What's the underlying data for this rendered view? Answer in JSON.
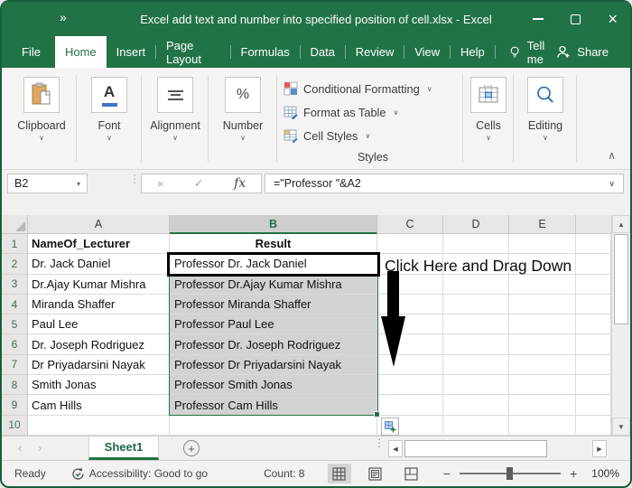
{
  "window": {
    "title": "Excel add text and number into specified position of cell.xlsx - Excel"
  },
  "tabs": {
    "items": [
      "File",
      "Home",
      "Insert",
      "Page Layout",
      "Formulas",
      "Data",
      "Review",
      "View",
      "Help"
    ],
    "active": "Home",
    "tell_me": "Tell me",
    "share": "Share"
  },
  "ribbon": {
    "clipboard": "Clipboard",
    "font": "Font",
    "alignment": "Alignment",
    "number": "Number",
    "styles_items": [
      "Conditional Formatting",
      "Format as Table",
      "Cell Styles"
    ],
    "styles_label": "Styles",
    "cells": "Cells",
    "editing": "Editing"
  },
  "formula_bar": {
    "name_box": "B2",
    "fx": "fx",
    "formula": "=\"Professor \"&A2"
  },
  "grid": {
    "columns": [
      "A",
      "B",
      "C",
      "D",
      "E"
    ],
    "selected_column": "B",
    "selected_range": "B2:B9",
    "rows": [
      {
        "n": "1",
        "a": "NameOf_Lecturer",
        "b": "Result"
      },
      {
        "n": "2",
        "a": "Dr. Jack Daniel",
        "b": "Professor Dr. Jack Daniel"
      },
      {
        "n": "3",
        "a": "Dr.Ajay Kumar Mishra",
        "b": "Professor Dr.Ajay Kumar Mishra"
      },
      {
        "n": "4",
        "a": "Miranda Shaffer",
        "b": "Professor Miranda Shaffer"
      },
      {
        "n": "5",
        "a": "Paul Lee",
        "b": "Professor Paul Lee"
      },
      {
        "n": "6",
        "a": "Dr. Joseph Rodriguez",
        "b": "Professor Dr. Joseph Rodriguez"
      },
      {
        "n": "7",
        "a": "Dr Priyadarsini Nayak",
        "b": "Professor Dr Priyadarsini Nayak"
      },
      {
        "n": "8",
        "a": "Smith Jonas",
        "b": "Professor Smith Jonas"
      },
      {
        "n": "9",
        "a": "Cam Hills",
        "b": "Professor Cam Hills"
      },
      {
        "n": "10",
        "a": "",
        "b": ""
      }
    ],
    "annotation": "Click Here and Drag Down"
  },
  "sheet_tabs": {
    "active": "Sheet1"
  },
  "status_bar": {
    "ready": "Ready",
    "accessibility": "Accessibility: Good to go",
    "count": "Count: 8",
    "zoom_level": "100%"
  },
  "icons": {
    "qat": "»",
    "close": "×",
    "dropdown": "▾",
    "chevron_down": "∨",
    "chevron_up": "∧",
    "dots": "⋮",
    "cancel": "×",
    "check": "✓",
    "up_arrow": "▲",
    "down_arrow": "▼",
    "left_arrow": "◀",
    "right_arrow": "▶",
    "nav_left": "‹",
    "nav_right": "›",
    "plus": "+",
    "minus": "−",
    "percent": "%",
    "font_letter": "A"
  },
  "colors": {
    "excel_green": "#217346",
    "selection_gray": "#d2d2d2",
    "annotation_black": "#000000"
  }
}
